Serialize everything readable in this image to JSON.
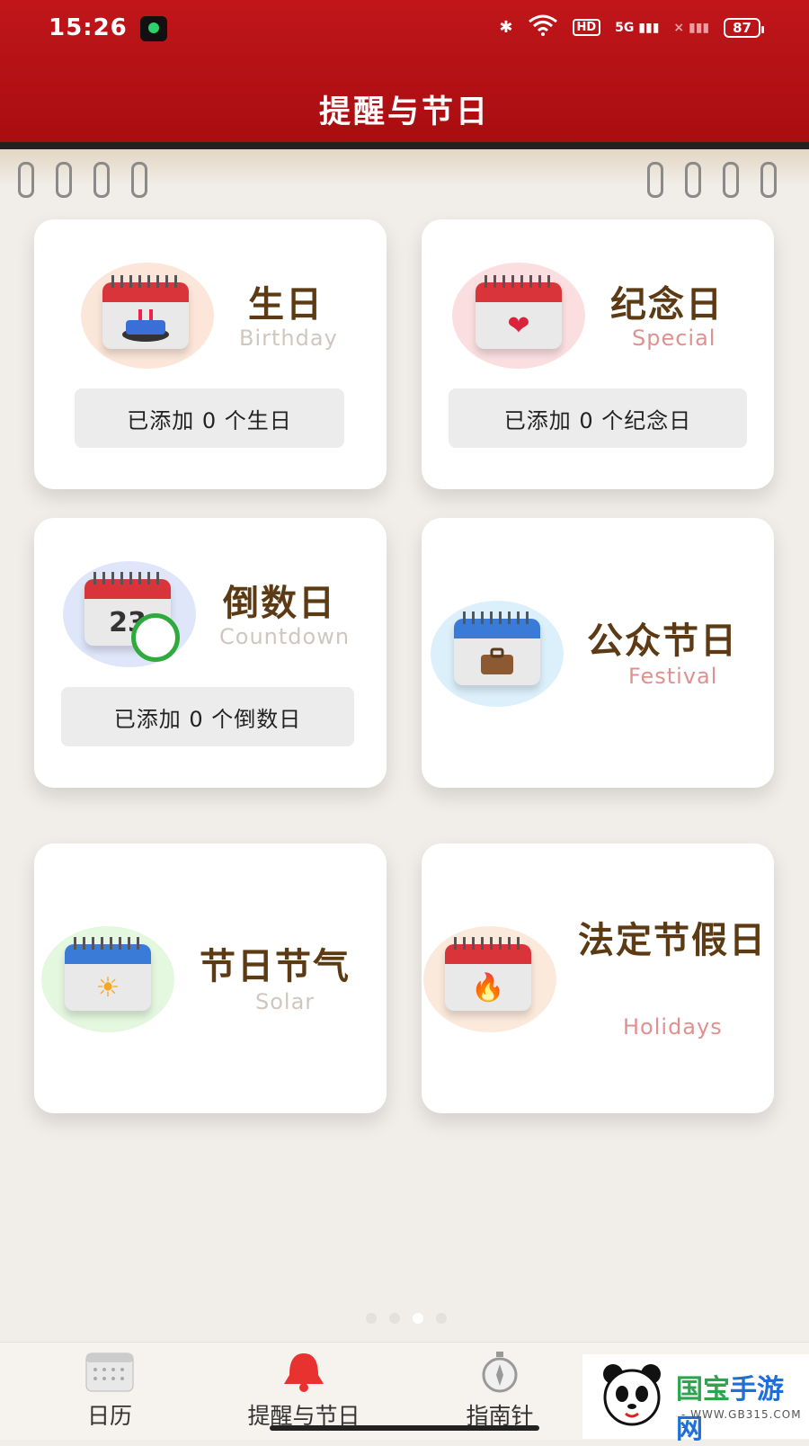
{
  "status_bar": {
    "time": "15:26",
    "network": "5G",
    "hd": "HD",
    "battery": "87"
  },
  "page": {
    "title": "提醒与节日"
  },
  "cards": [
    {
      "title": "生日",
      "subtitle": "Birthday",
      "count_label": "已添加 0 个生日",
      "icon": "birthday-calendar-icon",
      "color": "#fbe6d9"
    },
    {
      "title": "纪念日",
      "subtitle": "Special",
      "count_label": "已添加 0 个纪念日",
      "icon": "heart-calendar-icon",
      "color": "#fbdfe0"
    },
    {
      "title": "倒数日",
      "subtitle": "Countdown",
      "count_label": "已添加 0 个倒数日",
      "icon": "countdown-calendar-icon",
      "color": "#dfe6fa",
      "cal_number": "23"
    },
    {
      "title": "公众节日",
      "subtitle": "Festival",
      "icon": "briefcase-calendar-icon",
      "color": "#dcf0fb"
    },
    {
      "title": "节日节气",
      "subtitle": "Solar",
      "icon": "sun-calendar-icon",
      "color": "#e4f7df"
    },
    {
      "title": "法定节假日",
      "subtitle": "Holidays",
      "icon": "fire-calendar-icon",
      "color": "#fbe9dc"
    }
  ],
  "bottom_nav": [
    {
      "label": "日历",
      "icon": "calendar-icon"
    },
    {
      "label": "提醒与节日",
      "icon": "bell-icon"
    },
    {
      "label": "指南针",
      "icon": "compass-icon"
    }
  ],
  "watermark": {
    "title": "国宝手游网",
    "url": "- WWW.GB315.COM -"
  }
}
